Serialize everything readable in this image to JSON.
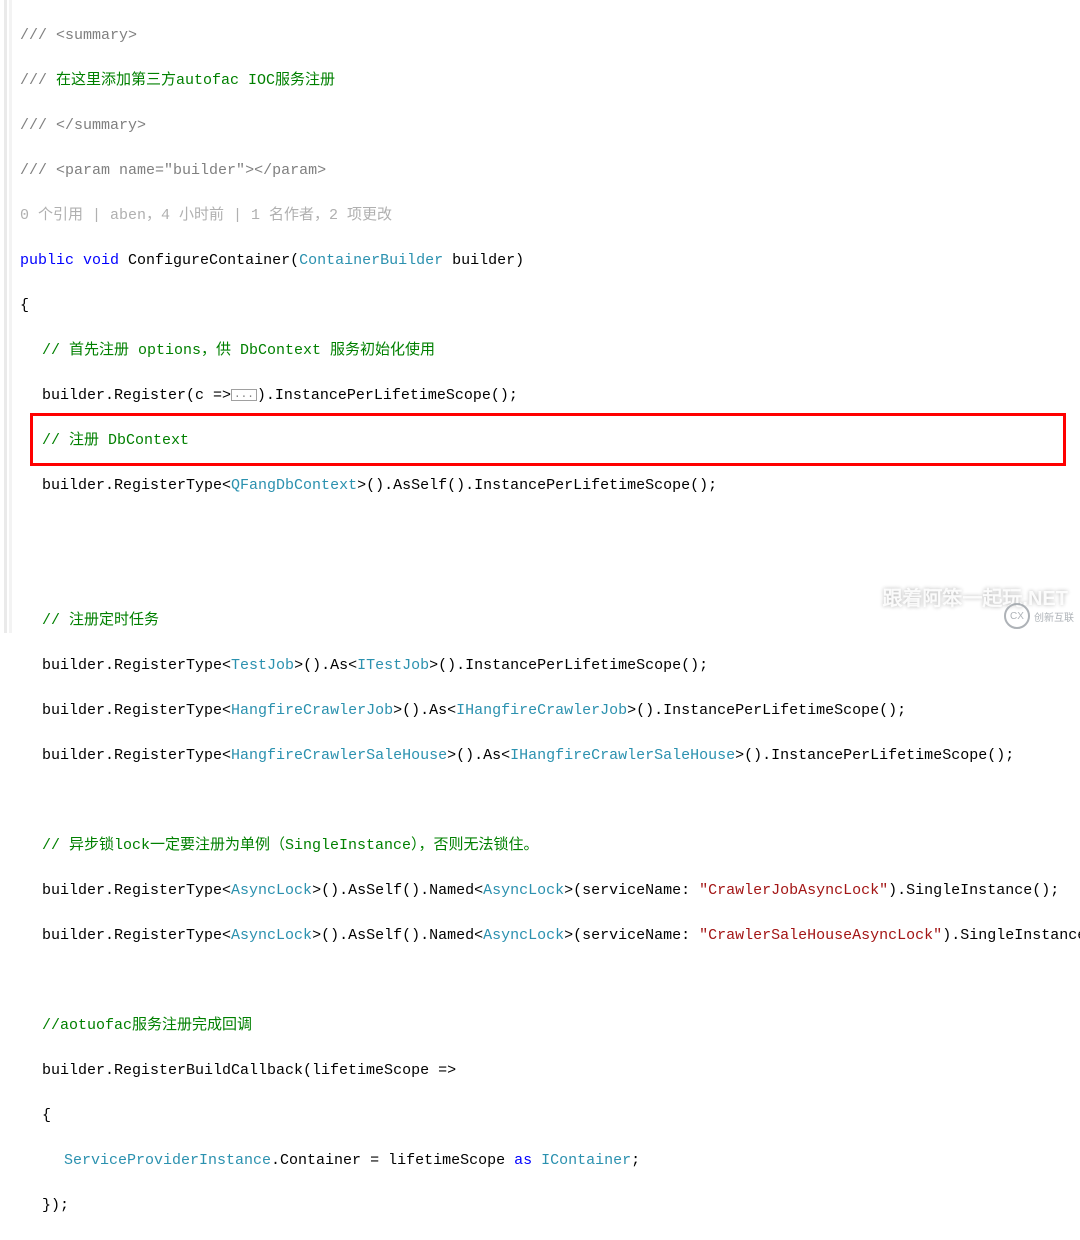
{
  "c": {
    "l1p": "/// ",
    "l1t": "<summary>",
    "l2p": "/// ",
    "l2t": "在这里添加第三方autofac IOC服务注册",
    "l3p": "/// ",
    "l3t": "</summary>",
    "l4p": "/// ",
    "l4a": "<param name=",
    "l4q": "\"builder\"",
    "l4b": "></param>",
    "l5": "0 个引用 | aben，4 小时前 | 1 名作者，2 项更改",
    "kw_public": "public",
    "kw_void": "void",
    "m_cfg": " ConfigureContainer(",
    "t_cb": "ContainerBuilder",
    "p_builder": " builder)",
    "brace_o": "{",
    "brace_c": "}",
    "brace_c_paren": "});",
    "c_opt": "// 首先注册 options，供 DbContext 服务初始化使用",
    "m_reg1a": ".Register(c =>",
    "m_reg1b": ").InstancePerLifetimeScope();",
    "fold": "...",
    "c_db": "// 注册 DbContext",
    "m_rt": ".RegisterType<",
    "t_qfang": "QFangDbContext",
    "m_asself_ipls": ">().AsSelf().InstancePerLifetimeScope();",
    "c_job": "// 注册定时任务",
    "t_testjob": "TestJob",
    "m_as": ">().As<",
    "t_itestjob": "ITestJob",
    "m_ipls": ">().InstancePerLifetimeScope();",
    "t_hcj": "HangfireCrawlerJob",
    "t_ihcj": "IHangfireCrawlerJob",
    "t_hcsh": "HangfireCrawlerSaleHouse",
    "t_ihcsh": "IHangfireCrawlerSaleHouse",
    "c_lock": "// 异步锁lock一定要注册为单例（SingleInstance），否则无法锁住。",
    "t_asynclock": "AsyncLock",
    "m_asself_named": ">().AsSelf().Named<",
    "m_svc": ">(serviceName: ",
    "s_crawlerjob": "\"CrawlerJobAsyncLock\"",
    "s_crawlersale": "\"CrawlerSaleHouseAsyncLock\"",
    "m_si": ").SingleInstance();",
    "c_cb": "//aotuofac服务注册完成回调",
    "m_rbc": ".RegisterBuildCallback(lifetimeScope =>",
    "t_spi": "ServiceProviderInstance",
    "m_cont": ".Container = lifetimeScope ",
    "kw_as": "as",
    "sp": " ",
    "t_icont": "IContainer",
    "semi": ";",
    "builder": "builder"
  },
  "watermark": "跟着阿笨一起玩.NET",
  "brand": "创新互联"
}
